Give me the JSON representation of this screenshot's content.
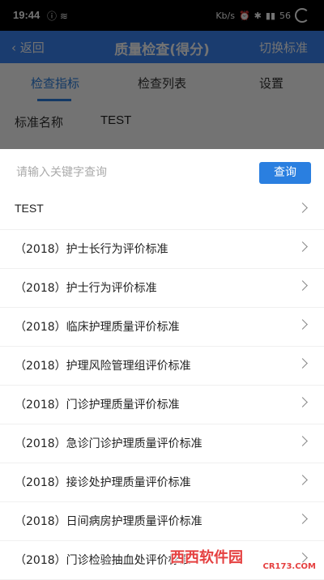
{
  "status": {
    "time": "19:44",
    "right": "Kb/s",
    "signal": "56"
  },
  "header": {
    "back": "返回",
    "title": "质量检查(得分)",
    "switch": "切换标准"
  },
  "tabs": [
    {
      "label": "检查指标"
    },
    {
      "label": "检查列表"
    },
    {
      "label": "设置"
    }
  ],
  "standard": {
    "name_label": "标准名称",
    "name_value": "TEST"
  },
  "search": {
    "placeholder": "请输入关键字查询",
    "button": "查询"
  },
  "list": [
    {
      "label": "TEST"
    },
    {
      "label": "（2018）护士长行为评价标准"
    },
    {
      "label": "（2018）护士行为评价标准"
    },
    {
      "label": "（2018）临床护理质量评价标准"
    },
    {
      "label": "（2018）护理风险管理组评价标准"
    },
    {
      "label": "（2018）门诊护理质量评价标准"
    },
    {
      "label": "（2018）急诊门诊护理质量评价标准"
    },
    {
      "label": "（2018）接诊处护理质量评价标准"
    },
    {
      "label": "（2018）日间病房护理质量评价标准"
    },
    {
      "label": "（2018）门诊检验抽血处评价标准"
    }
  ],
  "watermark": {
    "text": "西西软件园",
    "sub": "CR173.COM"
  }
}
